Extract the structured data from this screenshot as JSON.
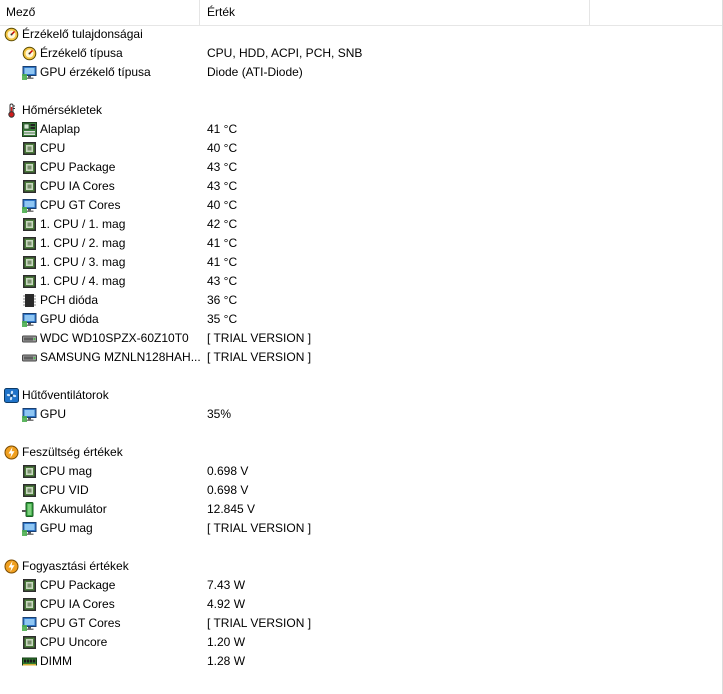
{
  "columns": {
    "field": "Mező",
    "value": "Érték"
  },
  "sections": [
    {
      "title": "Érzékelő tulajdonságai",
      "icon": "sensor-gauge-icon",
      "items": [
        {
          "label": "Érzékelő típusa",
          "value": "CPU, HDD, ACPI, PCH, SNB",
          "icon": "sensor-gauge-icon"
        },
        {
          "label": "GPU érzékelő típusa",
          "value": "Diode  (ATI-Diode)",
          "icon": "gpu-monitor-icon"
        }
      ]
    },
    {
      "title": "Hőmérsékletek",
      "icon": "thermometer-icon",
      "items": [
        {
          "label": "Alaplap",
          "value": "41 °C",
          "icon": "motherboard-icon"
        },
        {
          "label": "CPU",
          "value": "40 °C",
          "icon": "cpu-chip-icon"
        },
        {
          "label": "CPU Package",
          "value": "43 °C",
          "icon": "cpu-chip-icon"
        },
        {
          "label": "CPU IA Cores",
          "value": "43 °C",
          "icon": "cpu-chip-icon"
        },
        {
          "label": "CPU GT Cores",
          "value": "40 °C",
          "icon": "gpu-monitor-icon"
        },
        {
          "label": "1. CPU / 1. mag",
          "value": "42 °C",
          "icon": "cpu-chip-icon"
        },
        {
          "label": "1. CPU / 2. mag",
          "value": "41 °C",
          "icon": "cpu-chip-icon"
        },
        {
          "label": "1. CPU / 3. mag",
          "value": "41 °C",
          "icon": "cpu-chip-icon"
        },
        {
          "label": "1. CPU / 4. mag",
          "value": "43 °C",
          "icon": "cpu-chip-icon"
        },
        {
          "label": "PCH dióda",
          "value": "36 °C",
          "icon": "pch-chip-icon"
        },
        {
          "label": "GPU dióda",
          "value": "35 °C",
          "icon": "gpu-monitor-icon"
        },
        {
          "label": "WDC WD10SPZX-60Z10T0",
          "value": "[ TRIAL VERSION ]",
          "icon": "hard-drive-icon"
        },
        {
          "label": "SAMSUNG MZNLN128HAH...",
          "value": "[ TRIAL VERSION ]",
          "icon": "hard-drive-icon"
        }
      ]
    },
    {
      "title": "Hűtőventilátorok",
      "icon": "fan-icon",
      "items": [
        {
          "label": "GPU",
          "value": "35%",
          "icon": "gpu-monitor-icon"
        }
      ]
    },
    {
      "title": "Feszültség értékek",
      "icon": "voltage-icon",
      "items": [
        {
          "label": "CPU mag",
          "value": "0.698 V",
          "icon": "cpu-chip-icon"
        },
        {
          "label": "CPU VID",
          "value": "0.698 V",
          "icon": "cpu-chip-icon"
        },
        {
          "label": "Akkumulátor",
          "value": "12.845 V",
          "icon": "battery-icon"
        },
        {
          "label": "GPU mag",
          "value": "[ TRIAL VERSION ]",
          "icon": "gpu-monitor-icon"
        }
      ]
    },
    {
      "title": "Fogyasztási értékek",
      "icon": "voltage-icon",
      "items": [
        {
          "label": "CPU Package",
          "value": "7.43 W",
          "icon": "cpu-chip-icon"
        },
        {
          "label": "CPU IA Cores",
          "value": "4.92 W",
          "icon": "cpu-chip-icon"
        },
        {
          "label": "CPU GT Cores",
          "value": "[ TRIAL VERSION ]",
          "icon": "gpu-monitor-icon"
        },
        {
          "label": "CPU Uncore",
          "value": "1.20 W",
          "icon": "cpu-chip-icon"
        },
        {
          "label": "DIMM",
          "value": "1.28 W",
          "icon": "memory-module-icon"
        }
      ]
    }
  ]
}
